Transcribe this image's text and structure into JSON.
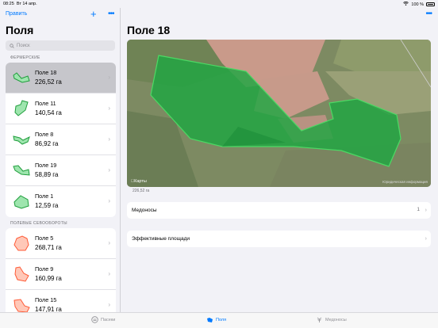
{
  "status_bar": {
    "time": "08:25",
    "date": "Вт 14 апр.",
    "battery": "100 %"
  },
  "sidebar": {
    "edit_label": "Править",
    "title": "Поля",
    "search_placeholder": "Поиск",
    "sections": [
      {
        "header": "ФЕРМЕРСКИЕ",
        "items": [
          {
            "name": "Поле 18",
            "area": "226,52 га",
            "selected": true
          },
          {
            "name": "Поле 11",
            "area": "140,54 га"
          },
          {
            "name": "Поле 8",
            "area": "86,92 га"
          },
          {
            "name": "Поле 19",
            "area": "58,89 га"
          },
          {
            "name": "Поле 1",
            "area": "12,59 га"
          }
        ]
      },
      {
        "header": "ПОЛЕВЫЕ СЕВООБОРОТЫ",
        "items": [
          {
            "name": "Поле 5",
            "area": "268,71 га"
          },
          {
            "name": "Поле 9",
            "area": "160,99 га"
          },
          {
            "name": "Поле 15",
            "area": "147,91 га"
          }
        ]
      }
    ]
  },
  "detail": {
    "title": "Поле 18",
    "map_label": "Карты",
    "map_legal": "Юридическая информация",
    "area_caption": "226,52 га",
    "rows": [
      {
        "label": "Медоносы",
        "count": "1"
      },
      {
        "label": "Эффективные площади"
      }
    ]
  },
  "tabbar": {
    "tabs": [
      {
        "label": "Пасеки",
        "icon": "apiary-icon"
      },
      {
        "label": "Поля",
        "icon": "field-icon",
        "active": true
      },
      {
        "label": "Медоносы",
        "icon": "honey-plant-icon"
      }
    ]
  },
  "colors": {
    "accent": "#007aff",
    "farm_field": "#34c759",
    "rotation_field": "#ff6b4a"
  }
}
